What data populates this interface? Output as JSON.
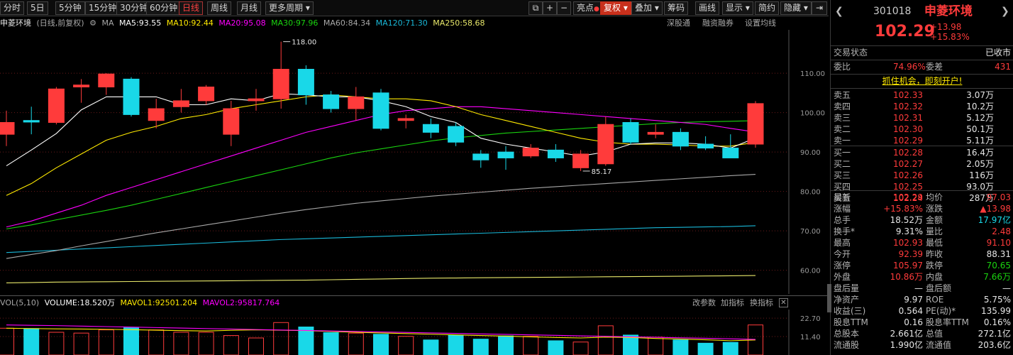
{
  "toolbar": {
    "periods": [
      "分时",
      "5日",
      "5分钟",
      "15分钟",
      "30分钟",
      "60分钟",
      "日线",
      "周线",
      "月线",
      "更多周期"
    ],
    "active_period": "日线",
    "buttons": [
      "亮点",
      "复权",
      "叠加",
      "筹码",
      "画线",
      "显示",
      "简约",
      "隐藏"
    ]
  },
  "stock": {
    "name": "申菱环境",
    "code": "301018",
    "price": "102.29",
    "change": "+13.98",
    "change_pct": "+15.83%"
  },
  "ma_line": {
    "name": "申菱环境",
    "mode": "(日线,前复权)",
    "ma_label": "MA",
    "ma5": "MA5:93.55",
    "ma10": "MA10:92.44",
    "ma20": "MA20:95.08",
    "ma30": "MA30:97.96",
    "ma60": "MA60:84.34",
    "ma120": "MA120:71.30",
    "ma250": "MA250:58.68",
    "links": [
      "深股通",
      "融资融券",
      "设置均线"
    ]
  },
  "vol_line": {
    "label": "VOL(5,10)",
    "volume": "VOLUME:18.520万",
    "mavol1": "MAVOL1:92501.204",
    "mavol2": "MAVOL2:95817.764",
    "links": [
      "改参数",
      "加指标",
      "换指标"
    ]
  },
  "colors": {
    "up": "#ff3b3b",
    "down": "#19d8e8",
    "ma5": "#ffffff",
    "ma10": "#ffea00",
    "ma20": "#ff00ff",
    "ma30": "#1ad40f",
    "ma60": "#a8a8a8",
    "ma120": "#19b8d8",
    "ma250": "#e8e86a"
  },
  "chart_data": {
    "type": "candlestick",
    "ylim": [
      54,
      121
    ],
    "y_ticks": [
      "110.00",
      "100.00",
      "90.00",
      "80.00",
      "70.00",
      "60.00"
    ],
    "y_tick_values": [
      110,
      100,
      90,
      80,
      70,
      60
    ],
    "annotations": [
      {
        "text": "118.00",
        "index": 11,
        "value": 118.0
      },
      {
        "text": "85.17",
        "index": 23,
        "value": 85.17
      }
    ],
    "candles": [
      {
        "o": 94.5,
        "h": 100.5,
        "l": 91.5,
        "c": 97.5
      },
      {
        "o": 98.0,
        "h": 101.5,
        "l": 94.5,
        "c": 97.6
      },
      {
        "o": 97.5,
        "h": 106.5,
        "l": 97.0,
        "c": 106.0
      },
      {
        "o": 106.5,
        "h": 108.5,
        "l": 102.5,
        "c": 107.0
      },
      {
        "o": 106.5,
        "h": 110.0,
        "l": 104.5,
        "c": 109.8
      },
      {
        "o": 108.5,
        "h": 109.0,
        "l": 99.0,
        "c": 99.5
      },
      {
        "o": 98.0,
        "h": 103.5,
        "l": 96.0,
        "c": 101.0
      },
      {
        "o": 101.5,
        "h": 106.0,
        "l": 100.0,
        "c": 103.0
      },
      {
        "o": 103.0,
        "h": 107.0,
        "l": 102.0,
        "c": 106.5
      },
      {
        "o": 94.5,
        "h": 103.0,
        "l": 91.5,
        "c": 101.0
      },
      {
        "o": 103.0,
        "h": 106.0,
        "l": 100.5,
        "c": 103.5
      },
      {
        "o": 103.5,
        "h": 118.0,
        "l": 101.0,
        "c": 111.0
      },
      {
        "o": 111.0,
        "h": 112.0,
        "l": 102.0,
        "c": 104.5
      },
      {
        "o": 104.5,
        "h": 105.5,
        "l": 100.0,
        "c": 101.0
      },
      {
        "o": 101.0,
        "h": 106.5,
        "l": 98.0,
        "c": 104.0
      },
      {
        "o": 105.0,
        "h": 106.0,
        "l": 95.5,
        "c": 96.0
      },
      {
        "o": 98.0,
        "h": 99.5,
        "l": 96.0,
        "c": 98.5
      },
      {
        "o": 97.0,
        "h": 98.5,
        "l": 93.5,
        "c": 95.0
      },
      {
        "o": 96.5,
        "h": 97.5,
        "l": 91.5,
        "c": 92.5
      },
      {
        "o": 89.5,
        "h": 90.5,
        "l": 86.0,
        "c": 88.0
      },
      {
        "o": 90.0,
        "h": 91.5,
        "l": 85.5,
        "c": 88.5
      },
      {
        "o": 89.0,
        "h": 92.0,
        "l": 88.5,
        "c": 91.0
      },
      {
        "o": 90.5,
        "h": 92.0,
        "l": 87.5,
        "c": 88.5
      },
      {
        "o": 86.0,
        "h": 90.5,
        "l": 85.17,
        "c": 89.5
      },
      {
        "o": 87.0,
        "h": 99.0,
        "l": 86.5,
        "c": 97.0
      },
      {
        "o": 97.5,
        "h": 98.5,
        "l": 92.0,
        "c": 92.5
      },
      {
        "o": 94.5,
        "h": 97.0,
        "l": 93.5,
        "c": 95.0
      },
      {
        "o": 95.0,
        "h": 96.0,
        "l": 90.5,
        "c": 91.5
      },
      {
        "o": 92.0,
        "h": 94.0,
        "l": 90.5,
        "c": 91.0
      },
      {
        "o": 91.0,
        "h": 94.5,
        "l": 88.5,
        "c": 88.5
      },
      {
        "o": 92.0,
        "h": 102.93,
        "l": 91.1,
        "c": 102.29
      }
    ],
    "ma5": [
      86.5,
      90.5,
      94.7,
      100.7,
      104.0,
      104.0,
      104.0,
      102.0,
      102.0,
      103.5,
      103.0,
      104.8,
      104.5,
      104.0,
      104.0,
      103.0,
      101.5,
      99.0,
      97.5,
      93.5,
      92.0,
      91.0,
      90.0,
      89.0,
      90.0,
      92.0,
      92.3,
      92.3,
      92.0,
      91.0,
      93.55
    ],
    "ma10": [
      79.0,
      82.0,
      86.0,
      89.5,
      93.0,
      95.0,
      96.5,
      98.5,
      99.5,
      101.0,
      102.0,
      103.0,
      104.0,
      104.5,
      104.0,
      103.5,
      103.5,
      103.0,
      101.5,
      99.5,
      98.0,
      96.5,
      95.0,
      93.5,
      92.5,
      92.0,
      92.0,
      91.8,
      91.5,
      91.5,
      92.44
    ],
    "ma20": [
      71.0,
      72.5,
      74.5,
      76.5,
      79.0,
      81.0,
      83.0,
      85.0,
      87.0,
      89.0,
      91.0,
      93.0,
      95.0,
      96.5,
      98.0,
      99.5,
      100.5,
      101.0,
      101.5,
      101.5,
      101.0,
      100.5,
      100.0,
      99.5,
      99.0,
      98.5,
      98.0,
      97.5,
      97.0,
      96.0,
      95.08
    ],
    "ma30": [
      70.5,
      71.5,
      72.8,
      74.0,
      75.2,
      76.5,
      78.0,
      79.5,
      81.0,
      82.5,
      84.0,
      85.5,
      87.0,
      88.5,
      89.8,
      90.8,
      91.8,
      92.8,
      93.6,
      94.2,
      94.8,
      95.2,
      95.6,
      96.0,
      96.4,
      96.8,
      97.2,
      97.5,
      97.7,
      97.8,
      97.96
    ],
    "ma60": [
      63.0,
      64.0,
      65.0,
      66.2,
      67.3,
      68.4,
      69.5,
      70.5,
      71.5,
      72.5,
      73.5,
      74.5,
      75.4,
      76.2,
      77.0,
      77.6,
      78.2,
      78.8,
      79.3,
      79.8,
      80.3,
      80.8,
      81.2,
      81.6,
      82.0,
      82.4,
      82.8,
      83.2,
      83.6,
      84.0,
      84.34
    ],
    "ma120": [
      64.5,
      64.8,
      65.1,
      65.4,
      65.7,
      66.0,
      66.3,
      66.6,
      66.9,
      67.2,
      67.5,
      67.8,
      68.0,
      68.2,
      68.4,
      68.6,
      68.8,
      69.0,
      69.2,
      69.4,
      69.6,
      69.8,
      70.0,
      70.2,
      70.4,
      70.6,
      70.8,
      70.9,
      71.0,
      71.1,
      71.3
    ],
    "ma250": [
      56.8,
      56.9,
      57.0,
      57.05,
      57.1,
      57.15,
      57.2,
      57.25,
      57.3,
      57.35,
      57.4,
      57.45,
      57.5,
      57.6,
      57.7,
      57.8,
      57.9,
      58.0,
      58.05,
      58.1,
      58.15,
      58.2,
      58.25,
      58.3,
      58.35,
      58.4,
      58.45,
      58.5,
      58.55,
      58.6,
      58.68
    ],
    "volume": {
      "ylim": [
        0,
        28
      ],
      "y_ticks": [
        "22.70",
        "11.40"
      ],
      "y_tick_values": [
        22.7,
        11.4
      ],
      "values": [
        16.5,
        16.5,
        14.0,
        13.5,
        15.5,
        17.0,
        15.5,
        14.0,
        14.0,
        12.0,
        10.5,
        20.0,
        17.5,
        14.0,
        13.5,
        13.0,
        11.5,
        9.5,
        12.5,
        10.0,
        12.0,
        11.5,
        9.0,
        8.0,
        18.0,
        12.5,
        11.0,
        9.5,
        7.5,
        8.0,
        18.52
      ],
      "mavol1": [
        16.5,
        16.3,
        16.1,
        16.0,
        15.8,
        15.6,
        15.3,
        15.0,
        14.8,
        15.2,
        15.5,
        15.3,
        15.0,
        14.5,
        14.0,
        13.6,
        13.2,
        12.8,
        12.4,
        12.0,
        11.6,
        11.2,
        10.8,
        10.5,
        11.0,
        10.8,
        10.2,
        9.8,
        9.4,
        8.8,
        9.25
      ],
      "mavol2": [
        18.5,
        18.3,
        18.1,
        17.8,
        17.5,
        17.2,
        16.9,
        16.6,
        16.3,
        16.0,
        15.7,
        15.4,
        15.1,
        14.8,
        14.5,
        14.2,
        13.9,
        13.6,
        13.3,
        13.0,
        12.7,
        12.4,
        12.1,
        11.8,
        11.5,
        11.2,
        10.9,
        10.6,
        10.3,
        10.0,
        9.58
      ]
    }
  },
  "order_book": {
    "header_labels": [
      "交易状态",
      "已收市"
    ],
    "weibi_label": "委比",
    "weibi": "74.96%",
    "weicha_label": "委差",
    "weicha": "431",
    "banner": "抓住机会，即刻开户!",
    "sells": [
      {
        "label": "卖五",
        "price": "102.33",
        "vol": "3.07万"
      },
      {
        "label": "卖四",
        "price": "102.32",
        "vol": "10.2万"
      },
      {
        "label": "卖三",
        "price": "102.31",
        "vol": "5.12万"
      },
      {
        "label": "卖二",
        "price": "102.30",
        "vol": "50.1万"
      },
      {
        "label": "卖一",
        "price": "102.29",
        "vol": "5.11万"
      }
    ],
    "buys": [
      {
        "label": "买一",
        "price": "102.28",
        "vol": "16.4万"
      },
      {
        "label": "买二",
        "price": "102.27",
        "vol": "2.05万"
      },
      {
        "label": "买三",
        "price": "102.26",
        "vol": "116万"
      },
      {
        "label": "买四",
        "price": "102.25",
        "vol": "93.0万"
      },
      {
        "label": "买五",
        "price": "102.24",
        "vol": "287万"
      }
    ]
  },
  "stats": [
    {
      "l1": "最新",
      "v1": "102.29",
      "c1": "red",
      "l2": "均价",
      "v2": "97.03",
      "c2": "red"
    },
    {
      "l1": "涨幅",
      "v1": "+15.83%",
      "c1": "red",
      "l2": "涨跌",
      "v2": "▲13.98",
      "c2": "red"
    },
    {
      "l1": "总手",
      "v1": "18.52万",
      "c1": "white",
      "l2": "金额",
      "v2": "17.97亿",
      "c2": "cyan"
    },
    {
      "l1": "换手*",
      "v1": "9.31%",
      "c1": "white",
      "l2": "量比",
      "v2": "2.48",
      "c2": "red"
    },
    {
      "l1": "最高",
      "v1": "102.93",
      "c1": "red",
      "l2": "最低",
      "v2": "91.10",
      "c2": "red"
    },
    {
      "l1": "今开",
      "v1": "92.39",
      "c1": "red",
      "l2": "昨收",
      "v2": "88.31",
      "c2": "white"
    },
    {
      "l1": "涨停",
      "v1": "105.97",
      "c1": "red",
      "l2": "跌停",
      "v2": "70.65",
      "c2": "green"
    },
    {
      "l1": "外盘",
      "v1": "10.86万",
      "c1": "red",
      "l2": "内盘",
      "v2": "7.66万",
      "c2": "green"
    },
    {
      "l1": "盘后量",
      "v1": "—",
      "c1": "white",
      "l2": "盘后额",
      "v2": "—",
      "c2": "white"
    },
    {
      "l1": "净资产",
      "v1": "9.97",
      "c1": "white",
      "l2": "ROE",
      "v2": "5.75%",
      "c2": "white"
    },
    {
      "l1": "收益(三)",
      "v1": "0.564",
      "c1": "white",
      "l2": "PE(动)*",
      "v2": "135.99",
      "c2": "white"
    },
    {
      "l1": "股息TTM",
      "v1": "0.16",
      "c1": "white",
      "l2": "股息率TTM",
      "v2": "0.16%",
      "c2": "white"
    },
    {
      "l1": "总股本",
      "v1": "2.661亿",
      "c1": "white",
      "l2": "总值",
      "v2": "272.1亿",
      "c2": "white"
    },
    {
      "l1": "流通股",
      "v1": "1.990亿",
      "c1": "white",
      "l2": "流通值",
      "v2": "203.6亿",
      "c2": "white"
    }
  ]
}
